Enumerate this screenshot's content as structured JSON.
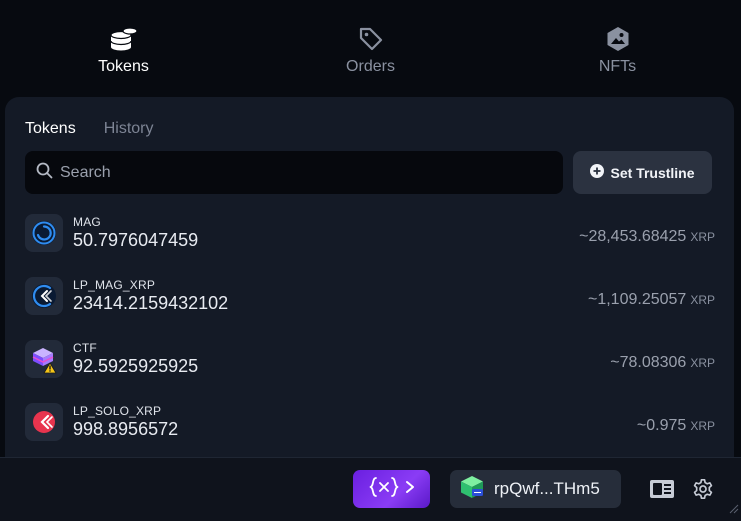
{
  "nav": {
    "tabs": [
      {
        "label": "Tokens",
        "icon": "coins-icon",
        "active": true
      },
      {
        "label": "Orders",
        "icon": "tag-icon",
        "active": false
      },
      {
        "label": "NFTs",
        "icon": "nft-image-icon",
        "active": false
      }
    ]
  },
  "panel": {
    "sub_tabs": [
      {
        "label": "Tokens",
        "active": true
      },
      {
        "label": "History",
        "active": false
      }
    ],
    "search": {
      "placeholder": "Search",
      "value": ""
    },
    "set_trustline_label": "Set Trustline",
    "tokens": [
      {
        "name": "MAG",
        "balance": "50.7976047459",
        "value": "~28,453.68425",
        "unit": "XRP",
        "icon": "mag-token-icon"
      },
      {
        "name": "LP_MAG_XRP",
        "balance": "23414.2159432102",
        "value": "~1,109.25057",
        "unit": "XRP",
        "icon": "lp-mag-token-icon"
      },
      {
        "name": "CTF",
        "balance": "92.5925925925",
        "value": "~78.08306",
        "unit": "XRP",
        "icon": "ctf-token-icon"
      },
      {
        "name": "LP_SOLO_XRP",
        "balance": "998.8956572",
        "value": "~0.975",
        "unit": "XRP",
        "icon": "lp-solo-token-icon"
      }
    ]
  },
  "footer": {
    "account_address": "rpQwf...THm5"
  },
  "colors": {
    "background": "#070a10",
    "panel": "#141a26",
    "xapp_accent": "#7b2ff0"
  }
}
